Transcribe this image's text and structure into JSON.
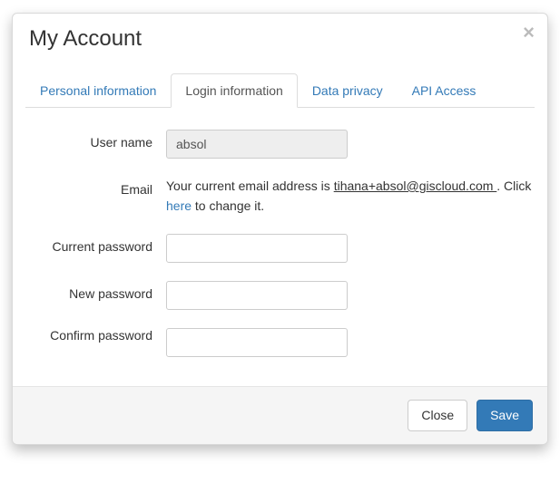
{
  "modal": {
    "title": "My Account",
    "close_glyph": "×"
  },
  "tabs": {
    "personal": "Personal information",
    "login": "Login information",
    "privacy": "Data privacy",
    "api": "API Access"
  },
  "form": {
    "username": {
      "label": "User name",
      "value": "absol"
    },
    "email": {
      "label": "Email",
      "prefix": "Your current email address is ",
      "address": "tihana+absol@giscloud.com ",
      "suffix1": ". Click ",
      "link": "here",
      "suffix2": " to change it."
    },
    "current_password": {
      "label": "Current password"
    },
    "new_password": {
      "label": "New password"
    },
    "confirm_password": {
      "label": "Confirm password"
    }
  },
  "footer": {
    "close": "Close",
    "save": "Save"
  }
}
